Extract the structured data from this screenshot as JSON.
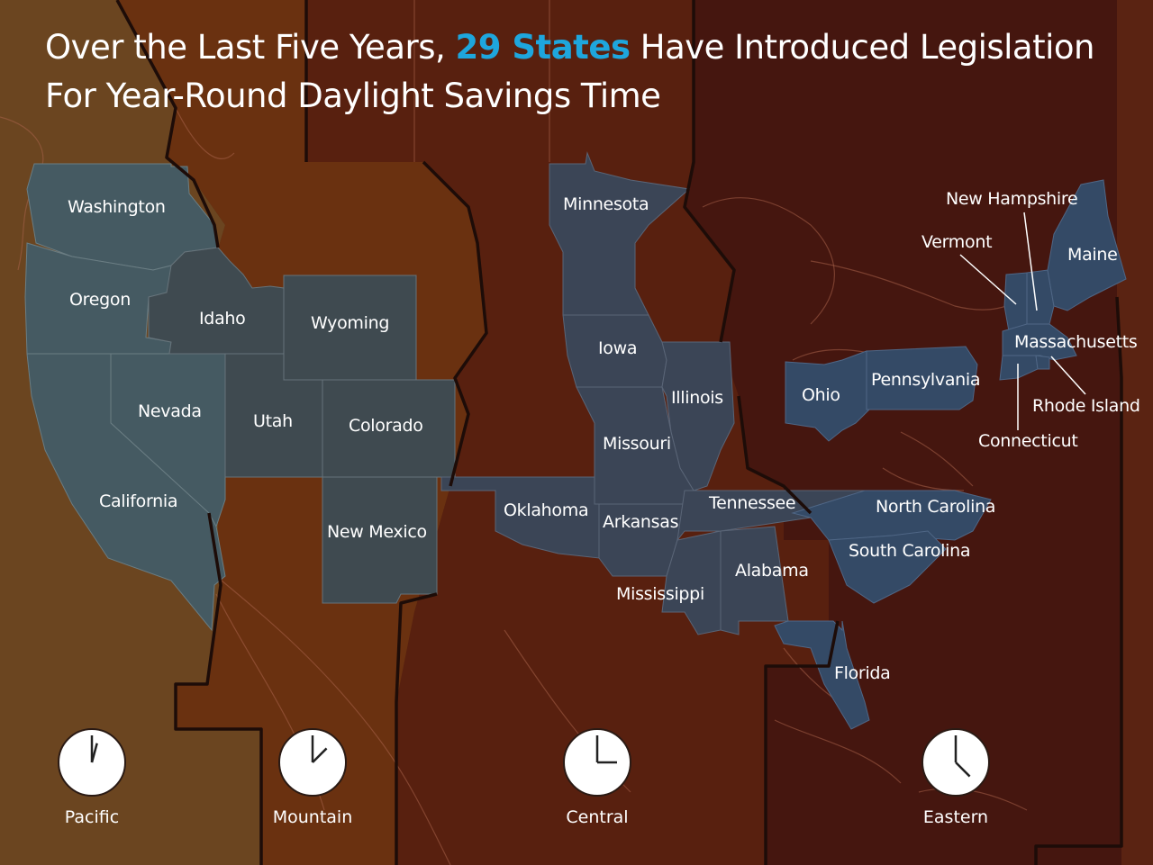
{
  "title": {
    "line1_before": "Over the Last Five Years, ",
    "line1_highlight": "29 States",
    "line1_after": " Have Introduced Legislation",
    "line2": "For Year-Round Daylight Savings Time",
    "highlight_color": "#1ea6dd"
  },
  "time_zones": {
    "colors": {
      "pacific": "#6b4520",
      "mountain": "#6a3110",
      "central": "#58200f",
      "eastern": "#45160f"
    },
    "clocks": [
      {
        "zone": "pacific",
        "label": "Pacific",
        "hour_hand_deg": 15,
        "minute_hand_deg": 0
      },
      {
        "zone": "mountain",
        "label": "Mountain",
        "hour_hand_deg": 45,
        "minute_hand_deg": 0
      },
      {
        "zone": "central",
        "label": "Central",
        "hour_hand_deg": 90,
        "minute_hand_deg": 0
      },
      {
        "zone": "eastern",
        "label": "Eastern",
        "hour_hand_deg": 135,
        "minute_hand_deg": 0
      }
    ]
  },
  "highlighted_state_count": 29,
  "states": [
    {
      "name": "Washington",
      "zone": "pacific"
    },
    {
      "name": "Oregon",
      "zone": "pacific"
    },
    {
      "name": "Idaho",
      "zone": "mountain"
    },
    {
      "name": "Wyoming",
      "zone": "mountain"
    },
    {
      "name": "Nevada",
      "zone": "pacific"
    },
    {
      "name": "Utah",
      "zone": "mountain"
    },
    {
      "name": "Colorado",
      "zone": "mountain"
    },
    {
      "name": "California",
      "zone": "pacific"
    },
    {
      "name": "New Mexico",
      "zone": "mountain"
    },
    {
      "name": "Minnesota",
      "zone": "central"
    },
    {
      "name": "Iowa",
      "zone": "central"
    },
    {
      "name": "Illinois",
      "zone": "central"
    },
    {
      "name": "Missouri",
      "zone": "central"
    },
    {
      "name": "Oklahoma",
      "zone": "central"
    },
    {
      "name": "Arkansas",
      "zone": "central"
    },
    {
      "name": "Tennessee",
      "zone": "central"
    },
    {
      "name": "Mississippi",
      "zone": "central"
    },
    {
      "name": "Alabama",
      "zone": "central"
    },
    {
      "name": "Ohio",
      "zone": "eastern"
    },
    {
      "name": "Pennsylvania",
      "zone": "eastern"
    },
    {
      "name": "North Carolina",
      "zone": "eastern"
    },
    {
      "name": "South Carolina",
      "zone": "eastern"
    },
    {
      "name": "Florida",
      "zone": "eastern"
    },
    {
      "name": "New Hampshire",
      "zone": "eastern"
    },
    {
      "name": "Vermont",
      "zone": "eastern"
    },
    {
      "name": "Maine",
      "zone": "eastern"
    },
    {
      "name": "Massachusetts",
      "zone": "eastern"
    },
    {
      "name": "Rhode Island",
      "zone": "eastern"
    },
    {
      "name": "Connecticut",
      "zone": "eastern"
    }
  ]
}
